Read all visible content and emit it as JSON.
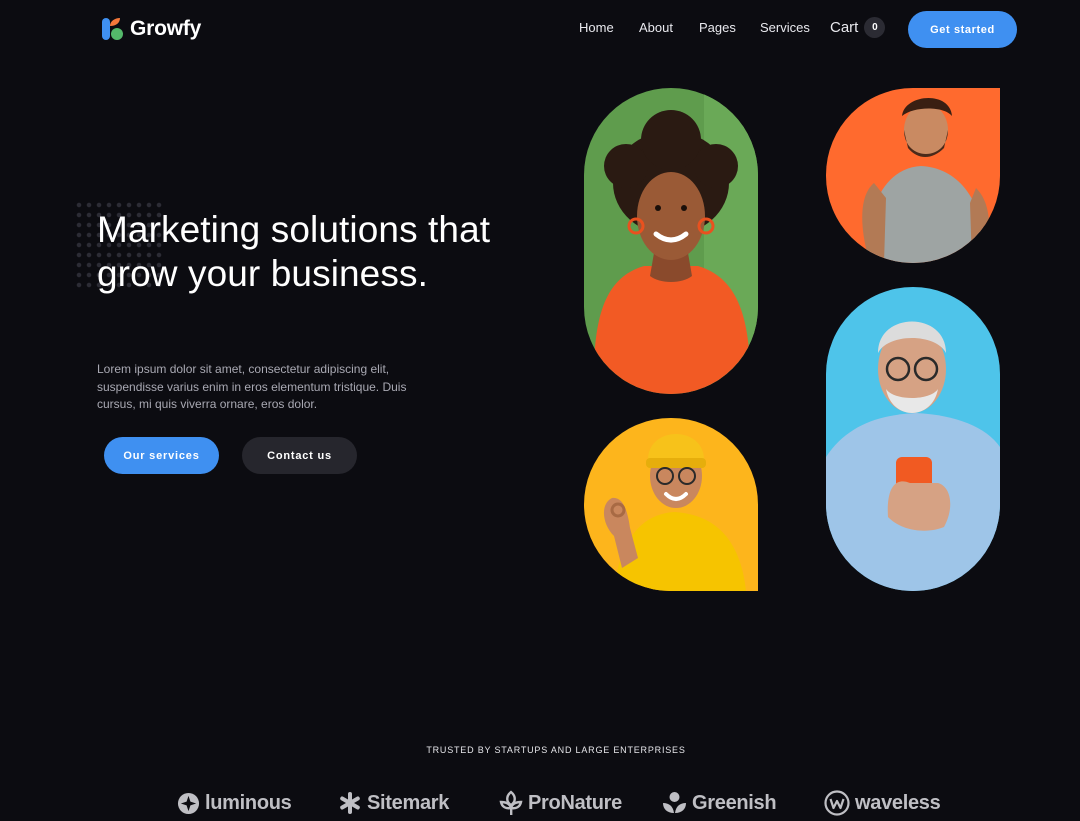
{
  "header": {
    "brand": "Growfy",
    "nav": [
      {
        "label": "Home"
      },
      {
        "label": "About"
      },
      {
        "label": "Pages"
      },
      {
        "label": "Services"
      }
    ],
    "cart_label": "Cart",
    "cart_count": "0",
    "cta": "Get started"
  },
  "hero": {
    "title": "Marketing solutions that grow your business.",
    "description": "Lorem ipsum dolor sit amet, consectetur adipiscing elit, suspendisse varius enim in eros elementum tristique. Duis cursus, mi quis viverra ornare, eros dolor.",
    "primary_button": "Our services",
    "secondary_button": "Contact us"
  },
  "photos": [
    {
      "icon": "woman-orange-shirt-photo",
      "bg": "#5f9c4d"
    },
    {
      "icon": "bearded-man-photo",
      "bg": "#ff6a2e"
    },
    {
      "icon": "man-yellow-beanie-photo",
      "bg": "#fdb51c"
    },
    {
      "icon": "older-man-phone-photo",
      "bg": "#4ec4ea"
    }
  ],
  "trusted": {
    "label": "TRUSTED BY STARTUPS AND LARGE ENTERPRISES",
    "logos": [
      {
        "name": "luminous",
        "icon": "luminous-logo-icon"
      },
      {
        "name": "Sitemark",
        "icon": "sitemark-logo-icon"
      },
      {
        "name": "ProNature",
        "icon": "pronature-logo-icon"
      },
      {
        "name": "Greenish",
        "icon": "greenish-logo-icon"
      },
      {
        "name": "waveless",
        "icon": "waveless-logo-icon"
      }
    ]
  },
  "colors": {
    "background": "#0c0c11",
    "accent": "#3f90f1",
    "secondary_button": "#26262d"
  }
}
